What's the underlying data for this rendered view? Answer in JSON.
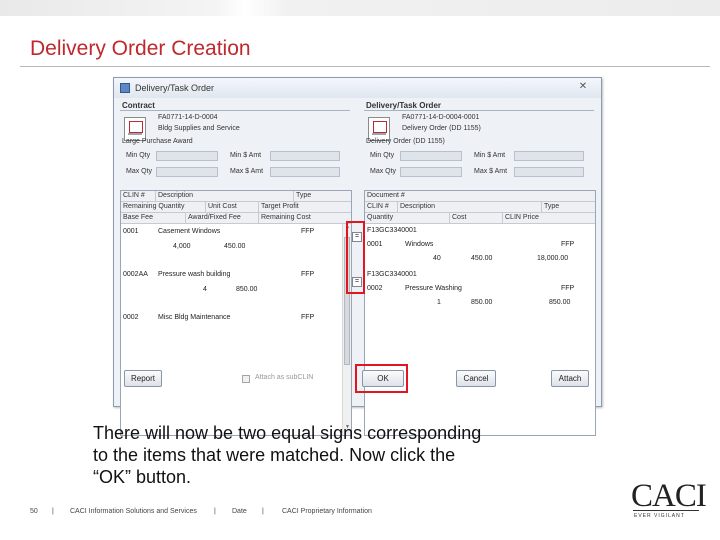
{
  "slide": {
    "title": "Delivery Order Creation",
    "caption_lines": [
      "There will now be two equal signs corresponding",
      "to the items that were matched.  Now click the",
      "“OK” button."
    ],
    "footer": {
      "page": "50",
      "sep": "|",
      "company": "CACI Information Solutions and Services",
      "date": "Date",
      "proprietary": "CACI Proprietary Information"
    },
    "logo": {
      "text": "CACI",
      "tagline": "EVER VIGILANT"
    }
  },
  "dialog": {
    "title": "Delivery/Task Order",
    "close_glyph": "✕",
    "contract": {
      "header": "Contract",
      "number": "FA0771-14-D-0004",
      "name": "Bldg Supplies and Service",
      "type": "Large Purchase Award",
      "min_qty_label": "Min Qty",
      "min_amt_label": "Min $ Amt",
      "max_qty_label": "Max Qty",
      "max_amt_label": "Max $ Amt"
    },
    "order": {
      "header": "Delivery/Task Order",
      "number": "FA0771-14-D-0004-0001",
      "name": "Delivery Order (DD 1155)",
      "type": "Delivery Order (DD 1155)",
      "min_qty_label": "Min Qty",
      "min_amt_label": "Min $ Amt",
      "max_qty_label": "Max Qty",
      "max_amt_label": "Max $ Amt"
    },
    "left_grid": {
      "headers_row1": [
        "CLIN #",
        "Description",
        "Type"
      ],
      "headers_row2": [
        "Remaining Quantity",
        "Unit Cost",
        "Target Profit"
      ],
      "headers_row3": [
        "Base Fee",
        "Award/Fixed Fee",
        "Remaining Cost"
      ],
      "rows": [
        {
          "clin": "0001",
          "desc": "Casement Windows",
          "type": "FFP",
          "qty": "4,000",
          "cost": "450.00"
        },
        {
          "clin": "0002AA",
          "desc": "Pressure wash building",
          "type": "FFP",
          "qty": "4",
          "cost": "850.00"
        },
        {
          "clin": "0002",
          "desc": "Misc Bldg Maintenance",
          "type": "FFP",
          "qty": "",
          "cost": ""
        }
      ]
    },
    "right_grid": {
      "headers_row1": [
        "Document #"
      ],
      "headers_row2": [
        "CLIN #",
        "Description",
        "Type"
      ],
      "headers_row3": [
        "Quantity",
        "Cost",
        "CLIN Price"
      ],
      "rows": [
        {
          "doc": "F13GC3340001",
          "clin": "0001",
          "desc": "Windows",
          "type": "FFP",
          "qty": "40",
          "cost": "450.00",
          "price": "18,000.00"
        },
        {
          "doc": "F13GC3340001",
          "clin": "0002",
          "desc": "Pressure Washing",
          "type": "FFP",
          "qty": "1",
          "cost": "850.00",
          "price": "850.00"
        }
      ]
    },
    "match_glyph": "=",
    "buttons": {
      "report": "Report",
      "attach_subclin": "Attach as subCLIN",
      "ok": "OK",
      "cancel": "Cancel",
      "attach": "Attach"
    }
  },
  "colors": {
    "title_red": "#c0282d",
    "highlight_red": "#e0171e"
  }
}
